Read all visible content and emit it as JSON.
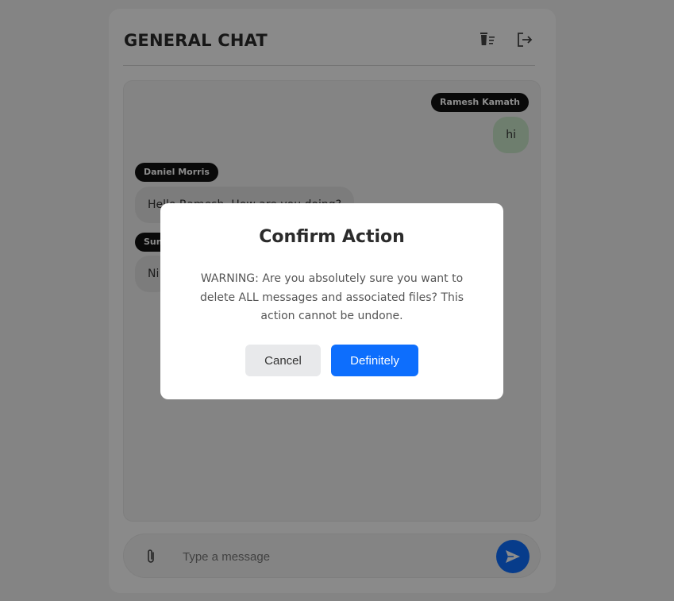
{
  "header": {
    "title": "GENERAL CHAT",
    "trash_icon": "trash-icon",
    "logout_icon": "logout-icon"
  },
  "messages": [
    {
      "sender": "Ramesh Kamath",
      "text": "hi",
      "self": true
    },
    {
      "sender": "Daniel Morris",
      "text": "Hello Ramesh, How are you doing?",
      "self": false
    },
    {
      "sender": "Sun",
      "text": "Ni",
      "self": false
    }
  ],
  "composer": {
    "placeholder": "Type a message",
    "attach_icon": "paperclip-icon",
    "send_icon": "send-icon"
  },
  "modal": {
    "title": "Confirm Action",
    "message": "WARNING: Are you absolutely sure you want to delete ALL messages and associated files? This action cannot be undone.",
    "cancel_label": "Cancel",
    "confirm_label": "Definitely"
  },
  "colors": {
    "accent": "#0d6efd",
    "self_bubble": "#c9e6c9",
    "other_bubble": "#e2e2e2",
    "name_tag": "#111111"
  }
}
